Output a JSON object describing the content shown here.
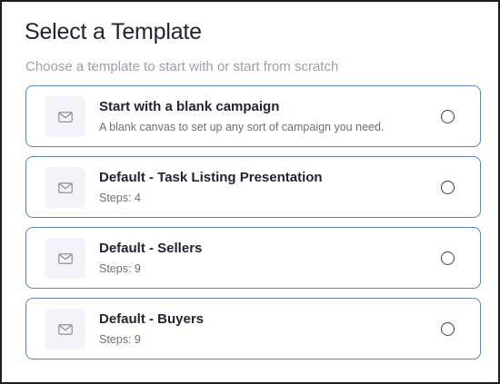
{
  "header": {
    "title": "Select a Template",
    "subtitle": "Choose a template to start with or start from scratch"
  },
  "templates": [
    {
      "title": "Start with a blank campaign",
      "description": "A blank canvas to set up any sort of campaign you need.",
      "icon": "envelope-icon",
      "selected": false
    },
    {
      "title": "Default - Task Listing Presentation",
      "description": "Steps: 4",
      "icon": "envelope-icon",
      "selected": false
    },
    {
      "title": "Default - Sellers",
      "description": "Steps: 9",
      "icon": "envelope-icon",
      "selected": false
    },
    {
      "title": "Default - Buyers",
      "description": "Steps: 9",
      "icon": "envelope-icon",
      "selected": false
    }
  ],
  "colors": {
    "card_border": "#5f86b6",
    "icon_background": "#f4f3f9",
    "icon_stroke": "#8a8fa0",
    "title_text": "#1f2430",
    "muted_text": "#9aa1ab"
  }
}
